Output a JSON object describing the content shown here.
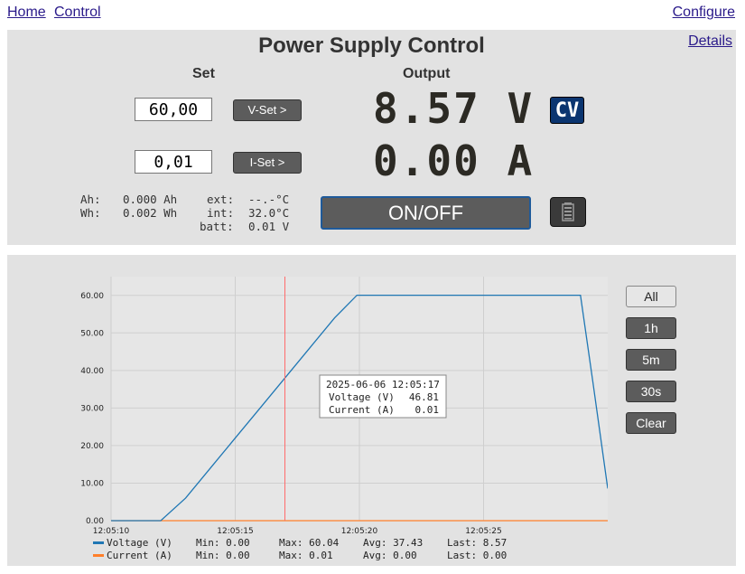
{
  "nav": {
    "home": "Home",
    "control": "Control",
    "configure": "Configure"
  },
  "panel": {
    "title": "Power Supply Control",
    "details": "Details",
    "set_header": "Set",
    "output_header": "Output",
    "voltage_input": "60,00",
    "current_input": "0,01",
    "vset_label": "V-Set >",
    "iset_label": "I-Set >",
    "voltage_out": "8.57 V",
    "current_out": "0.00 A",
    "mode_badge": "CV",
    "ah_label": "Ah:",
    "ah_value": "0.000 Ah",
    "wh_label": "Wh:",
    "wh_value": "0.002 Wh",
    "ext_label": "ext:",
    "ext_value": "--.-°C",
    "int_label": "int:",
    "int_value": "32.0°C",
    "batt_label": "batt:",
    "batt_value": "0.01 V",
    "onoff_label": "ON/OFF",
    "battery_icon": "battery-icon"
  },
  "range_buttons": [
    "All",
    "1h",
    "5m",
    "30s",
    "Clear"
  ],
  "colors": {
    "voltage": "#1f77b4",
    "current": "#ff7f2a",
    "cursor": "#ff6b6b",
    "cv_badge": "#0b3570",
    "onoff_border": "#1f5a9a"
  },
  "chart_data": {
    "type": "line",
    "x_ticks": [
      "12:05:10",
      "12:05:15",
      "12:05:20",
      "12:05:25"
    ],
    "xlim": [
      "12:05:10",
      "12:05:30"
    ],
    "y_ticks": [
      "0.00",
      "10.00",
      "20.00",
      "30.00",
      "40.00",
      "50.00",
      "60.00"
    ],
    "ylim": [
      0,
      65
    ],
    "grid": true,
    "series": [
      {
        "name": "Voltage (V)",
        "points": [
          [
            "12:05:10",
            0.0
          ],
          [
            "12:05:12",
            0.0
          ],
          [
            "12:05:13",
            6.0
          ],
          [
            "12:05:14",
            14.0
          ],
          [
            "12:05:15",
            22.0
          ],
          [
            "12:05:16",
            30.0
          ],
          [
            "12:05:17",
            38.0
          ],
          [
            "12:05:18",
            46.0
          ],
          [
            "12:05:19",
            54.0
          ],
          [
            "12:05:19.9",
            60.04
          ],
          [
            "12:05:28.9",
            60.04
          ],
          [
            "12:05:29.4",
            37.0
          ],
          [
            "12:05:30",
            8.57
          ]
        ],
        "min": "Min: 0.00",
        "max": "Max: 60.04",
        "avg": "Avg: 37.43",
        "last": "Last: 8.57"
      },
      {
        "name": "Current (A)",
        "points": [
          [
            "12:05:10",
            0.0
          ],
          [
            "12:05:30",
            0.0
          ]
        ],
        "min": "Min: 0.00",
        "max": "Max: 0.01",
        "avg": "Avg: 0.00",
        "last": "Last: 0.00"
      }
    ],
    "cursor": {
      "time": "12:05:17",
      "date_label": "2025-06-06 12:05:17",
      "voltage_label": "Voltage (V)",
      "voltage_value": "46.81",
      "current_label": "Current (A)",
      "current_value": "0.01"
    }
  }
}
